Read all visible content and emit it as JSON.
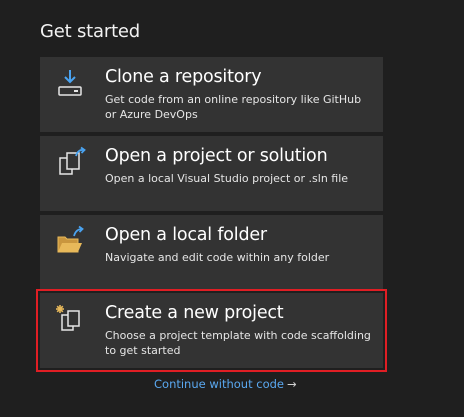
{
  "get_started": {
    "heading": "Get started",
    "options": [
      {
        "title": "Clone a repository",
        "description": "Get code from an online repository like GitHub or Azure DevOps",
        "icon": "download-icon"
      },
      {
        "title": "Open a project or solution",
        "description": "Open a local Visual Studio project or .sln file",
        "icon": "open-solution-icon"
      },
      {
        "title": "Open a local folder",
        "description": "Navigate and edit code within any folder",
        "icon": "open-folder-icon"
      },
      {
        "title": "Create a new project",
        "description": "Choose a project template with code scaffolding to get started",
        "icon": "new-project-icon",
        "highlighted": true
      }
    ],
    "continue_link": "Continue without code",
    "continue_arrow": "→"
  },
  "colors": {
    "background": "#1f1f1f",
    "card": "#333333",
    "highlight": "#e01e24",
    "link": "#5aa8f0",
    "folder": "#e8b95a"
  }
}
